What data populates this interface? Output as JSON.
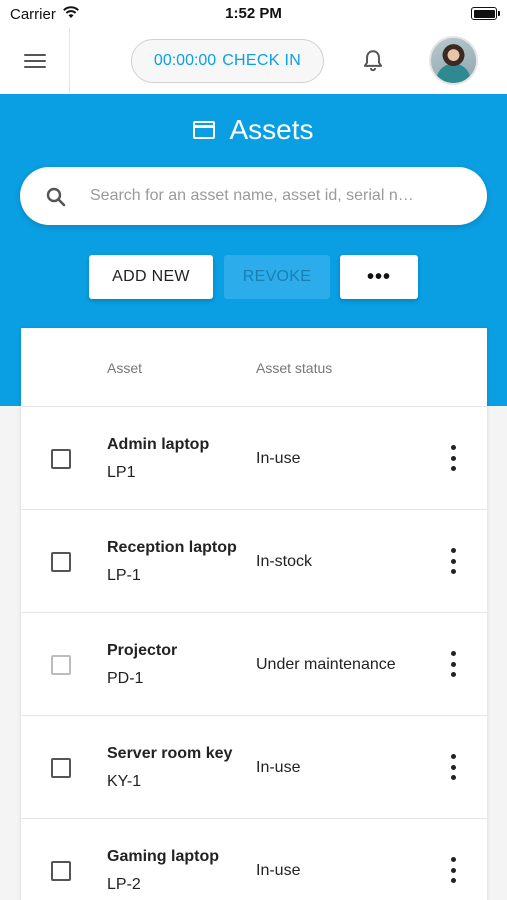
{
  "status_bar": {
    "carrier": "Carrier",
    "time": "1:52 PM"
  },
  "topbar": {
    "timer": "00:00:00",
    "checkin_label": "CHECK IN"
  },
  "header": {
    "title": "Assets",
    "search_placeholder": "Search for an asset name, asset id, serial n…",
    "add_new_label": "ADD NEW",
    "revoke_label": "REVOKE",
    "more_label": "•••"
  },
  "table": {
    "columns": {
      "asset": "Asset",
      "status": "Asset status"
    },
    "rows": [
      {
        "name": "Admin laptop",
        "id": "LP1",
        "status": "In-use",
        "checkbox_enabled": true
      },
      {
        "name": "Reception laptop",
        "id": "LP-1",
        "status": "In-stock",
        "checkbox_enabled": true
      },
      {
        "name": "Projector",
        "id": "PD-1",
        "status": "Under maintenance",
        "checkbox_enabled": false
      },
      {
        "name": "Server room key",
        "id": "KY-1",
        "status": "In-use",
        "checkbox_enabled": true
      },
      {
        "name": "Gaming laptop",
        "id": "LP-2",
        "status": "In-use",
        "checkbox_enabled": true
      }
    ]
  },
  "icons": {
    "menu": "hamburger-menu-icon",
    "bell": "bell-icon",
    "search": "search-icon",
    "title": "window-icon",
    "row_menu": "more-vertical-icon"
  },
  "colors": {
    "accent": "#0a9ee2",
    "checkin_text": "#0aa0e6",
    "revoke_disabled": "#2cacea"
  }
}
